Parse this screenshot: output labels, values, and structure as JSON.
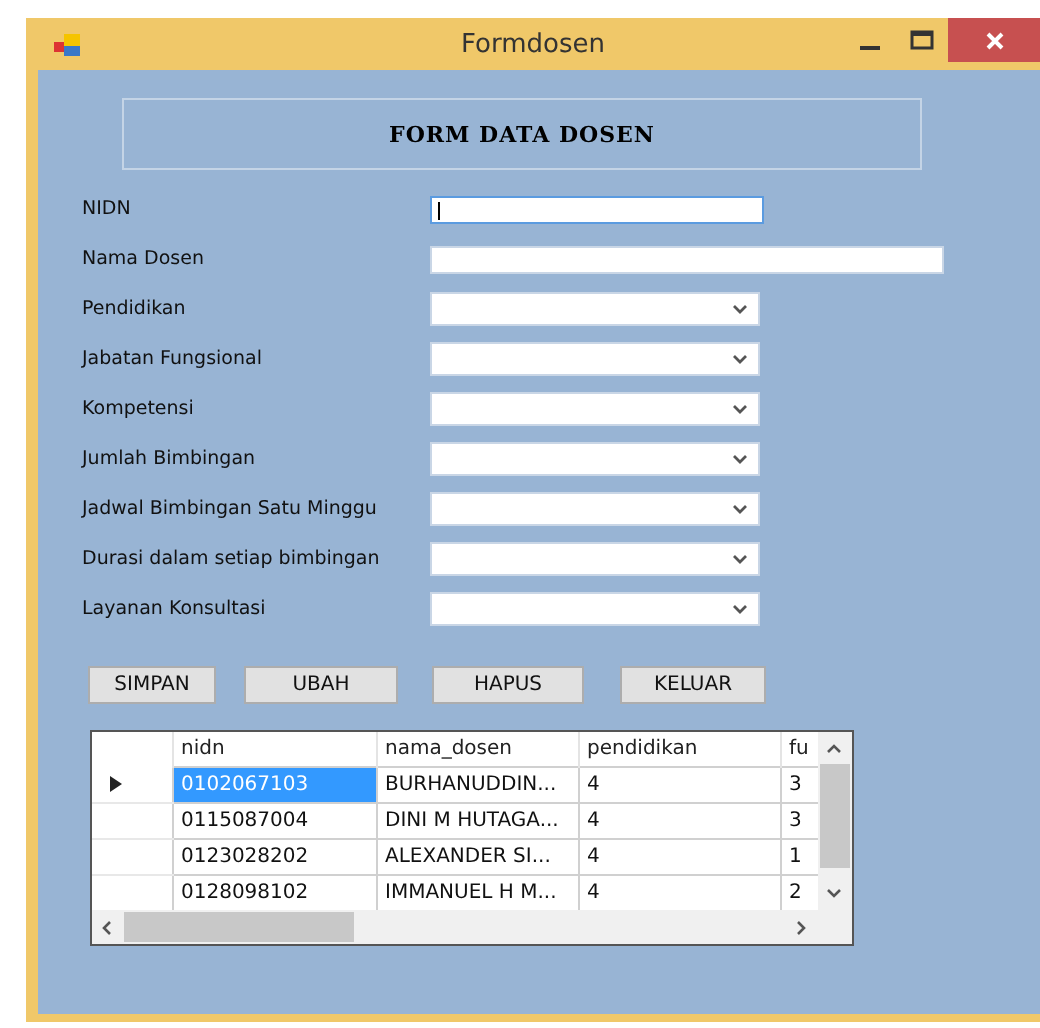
{
  "window": {
    "title": "Formdosen"
  },
  "header": {
    "title": "FORM DATA DOSEN"
  },
  "fields": [
    {
      "label": "NIDN",
      "kind": "text",
      "focused": true,
      "wide": false
    },
    {
      "label": "Nama Dosen",
      "kind": "text",
      "focused": false,
      "wide": true
    },
    {
      "label": "Pendidikan",
      "kind": "combo"
    },
    {
      "label": "Jabatan Fungsional",
      "kind": "combo"
    },
    {
      "label": "Kompetensi",
      "kind": "combo"
    },
    {
      "label": "Jumlah Bimbingan",
      "kind": "combo"
    },
    {
      "label": "Jadwal Bimbingan Satu Minggu",
      "kind": "combo"
    },
    {
      "label": "Durasi dalam setiap bimbingan",
      "kind": "combo"
    },
    {
      "label": "Layanan Konsultasi",
      "kind": "combo"
    }
  ],
  "buttons": [
    "SIMPAN",
    "UBAH",
    "HAPUS",
    "KELUAR"
  ],
  "table": {
    "columns": [
      "nidn",
      "nama_dosen",
      "pendidikan",
      "fu"
    ],
    "rows": [
      {
        "current": true,
        "selected": true,
        "cells": [
          "0102067103",
          "BURHANUDDIN...",
          "4",
          "3"
        ]
      },
      {
        "current": false,
        "selected": false,
        "cells": [
          "0115087004",
          "DINI M HUTAGA...",
          "4",
          "3"
        ]
      },
      {
        "current": false,
        "selected": false,
        "cells": [
          "0123028202",
          "ALEXANDER SI...",
          "4",
          "1"
        ]
      },
      {
        "current": false,
        "selected": false,
        "cells": [
          "0128098102",
          "IMMANUEL H M...",
          "4",
          "2"
        ]
      }
    ]
  }
}
